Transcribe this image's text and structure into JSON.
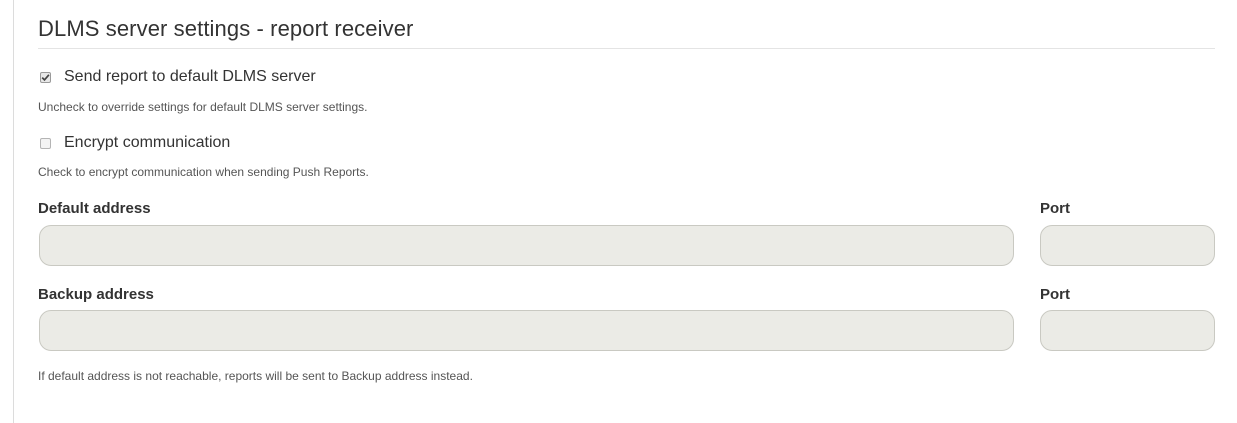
{
  "section": {
    "title": "DLMS server settings - report receiver"
  },
  "send_default": {
    "checked": true,
    "label": "Send report to default DLMS server",
    "help": "Uncheck to override settings for default DLMS server settings."
  },
  "encrypt": {
    "checked": false,
    "label": "Encrypt communication",
    "help": "Check to encrypt communication when sending Push Reports."
  },
  "default_address": {
    "label": "Default address",
    "value": "",
    "port_label": "Port",
    "port_value": ""
  },
  "backup_address": {
    "label": "Backup address",
    "value": "",
    "port_label": "Port",
    "port_value": ""
  },
  "footer_help": "If default address is not reachable, reports will be sent to Backup address instead."
}
